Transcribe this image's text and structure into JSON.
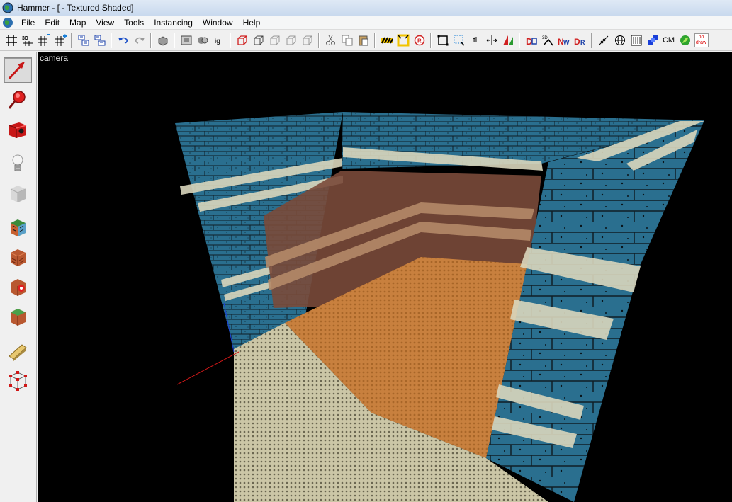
{
  "window": {
    "title": "Hammer - [ - Textured Shaded]"
  },
  "menu": {
    "items": [
      "File",
      "Edit",
      "Map",
      "View",
      "Tools",
      "Instancing",
      "Window",
      "Help"
    ]
  },
  "toolbar": {
    "text_buttons": {
      "tl": "tl",
      "cm": "CM",
      "nodraw_line1": "no",
      "nodraw_line2": "draw"
    }
  },
  "viewport": {
    "label": "camera"
  },
  "colors": {
    "brick_blue": "#2a6f8f",
    "brick_cream": "#d9d6bc",
    "floor_orange": "#c8803e",
    "floor_cream": "#cbc6a6",
    "axis_red": "#d01818"
  }
}
